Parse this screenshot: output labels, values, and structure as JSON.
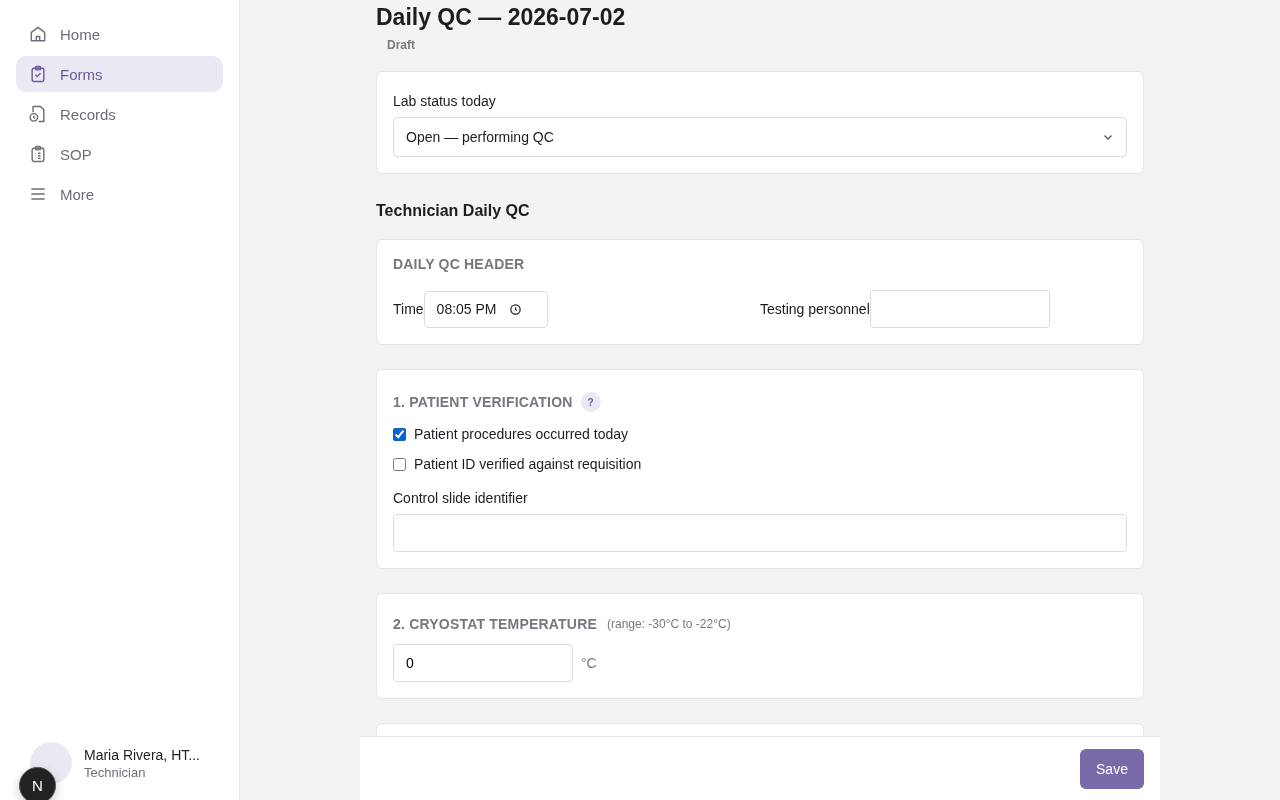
{
  "sidebar": {
    "items": [
      {
        "label": "Home",
        "kind": "home",
        "selected": false
      },
      {
        "label": "Forms",
        "kind": "forms",
        "selected": true
      },
      {
        "label": "Records",
        "kind": "records",
        "selected": false
      },
      {
        "label": "SOP",
        "kind": "sop",
        "selected": false
      },
      {
        "label": "More",
        "kind": "more",
        "selected": false
      }
    ],
    "user": {
      "name": "Maria Rivera, HT...",
      "role": "Technician"
    },
    "dev_badge": "N"
  },
  "page": {
    "title": "Daily QC — 2026-07-02",
    "status": "Draft"
  },
  "lab_status": {
    "label": "Lab status today",
    "value": "Open — performing QC"
  },
  "section_title": "Technician Daily QC",
  "header_card": {
    "title": "DAILY QC HEADER",
    "time_label": "Time",
    "time_value": "08:05 PM",
    "personnel_label": "Testing personnel"
  },
  "patient_card": {
    "title": "1. PATIENT VERIFICATION",
    "help": "?",
    "checks": [
      {
        "label": "Patient procedures occurred today",
        "checked": true
      },
      {
        "label": "Patient ID verified against requisition",
        "checked": false
      }
    ],
    "slide_label": "Control slide identifier"
  },
  "cryostat_card": {
    "title": "2. CRYOSTAT TEMPERATURE",
    "range": "(range: -30°C to -22°C)",
    "value": "0",
    "unit": "°C"
  },
  "footer": {
    "save": "Save"
  }
}
